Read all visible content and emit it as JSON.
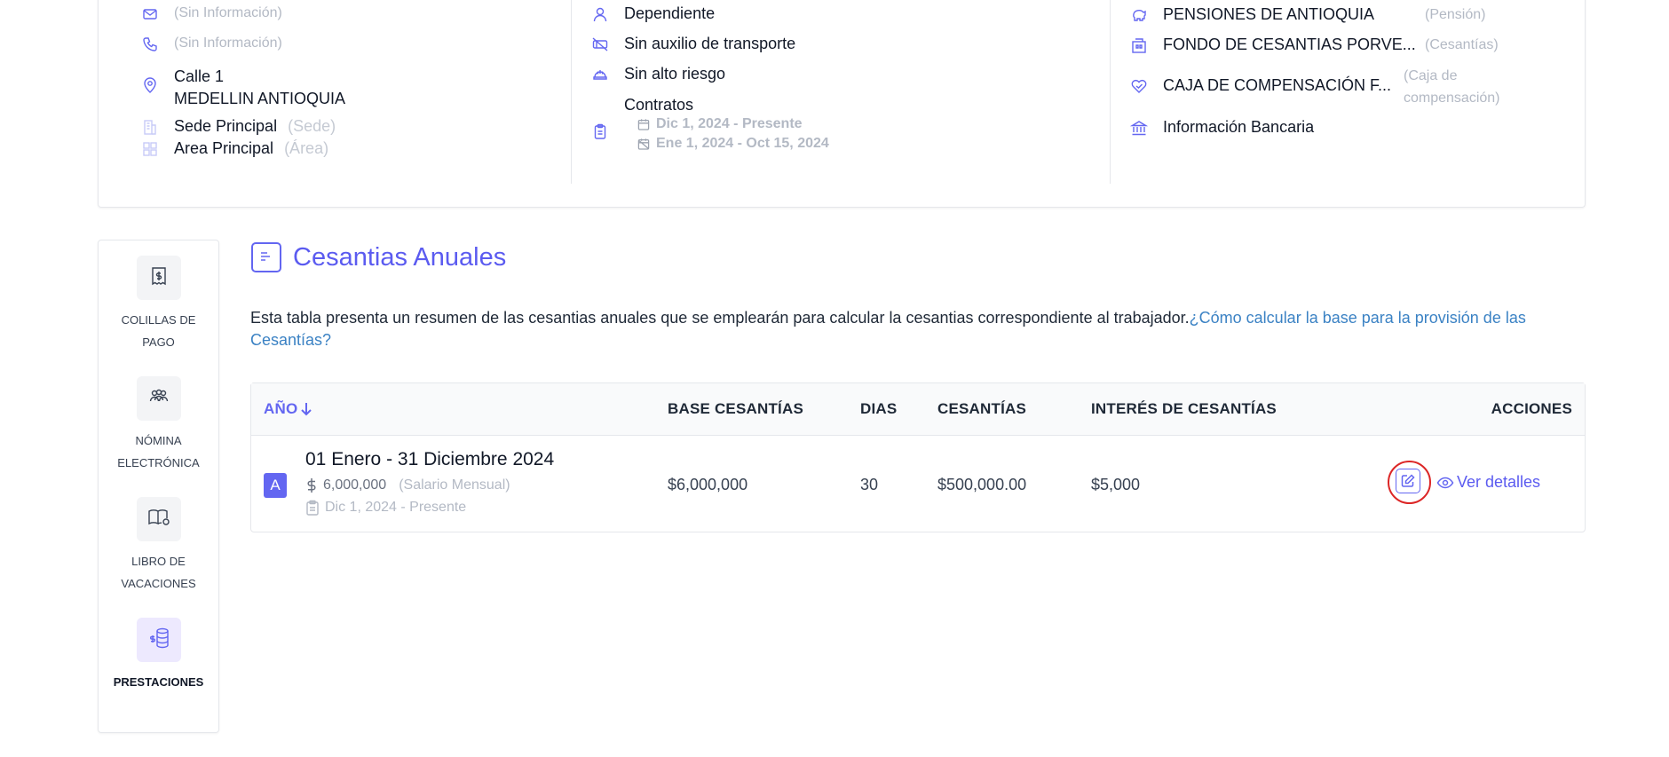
{
  "employee_card": {
    "col1": {
      "email": "(Sin Información)",
      "phone": "(Sin Información)",
      "address_line1": "Calle 1",
      "address_line2": "MEDELLIN ANTIOQUIA",
      "sede_name": "Sede Principal",
      "sede_type": "(Sede)",
      "area_name": "Area Principal",
      "area_type": "(Área)"
    },
    "col2": {
      "worker_type": "Dependiente",
      "transport": "Sin auxilio de transporte",
      "risk": "Sin alto riesgo",
      "contracts_label": "Contratos",
      "contract1": "Dic 1, 2024 - Presente",
      "contract2": "Ene 1, 2024 - Oct 15, 2024"
    },
    "col3": {
      "pension_name": "PENSIONES DE ANTIOQUIA",
      "pension_type": "(Pensión)",
      "cesantias_name": "FONDO DE CESANTIAS PORVE...",
      "cesantias_type": "(Cesantías)",
      "caja_name": "CAJA DE COMPENSACIÓN F...",
      "caja_type_1": "(Caja de",
      "caja_type_2": "compensación)",
      "bank": "Información Bancaria"
    }
  },
  "sidebar": {
    "items": [
      {
        "line1": "COLILLAS DE",
        "line2": "PAGO",
        "icon": "receipt-icon"
      },
      {
        "line1": "NÓMINA",
        "line2": "ELECTRÓNICA",
        "icon": "users-icon"
      },
      {
        "line1": "LIBRO DE",
        "line2": "VACACIONES",
        "icon": "book-icon"
      },
      {
        "line1": "PRESTACIONES",
        "line2": "",
        "icon": "coins-icon"
      }
    ]
  },
  "main": {
    "title": "Cesantias Anuales",
    "description": "Esta tabla presenta un resumen de las cesantias anuales que se emplearán para calcular la cesantias correspondiente al trabajador.",
    "help_link": "¿Cómo calcular la base para la provisión de las Cesantías?"
  },
  "table": {
    "headers": {
      "year": "AÑO",
      "base": "BASE CESANTÍAS",
      "days": "DIAS",
      "cesantias": "CESANTÍAS",
      "interest": "INTERÉS DE CESANTÍAS",
      "actions": "ACCIONES"
    },
    "row": {
      "badge": "A",
      "period": "01 Enero - 31 Diciembre 2024",
      "salary": "6,000,000",
      "salary_type": "(Salario Mensual)",
      "contract": "Dic 1, 2024 - Presente",
      "base": "$6,000,000",
      "days": "30",
      "cesantias": "$500,000.00",
      "interest": "$5,000",
      "view_label": "Ver detalles"
    }
  },
  "colors": {
    "accent": "#6366f1",
    "link": "#3b82c4",
    "highlight": "#dc2626"
  }
}
